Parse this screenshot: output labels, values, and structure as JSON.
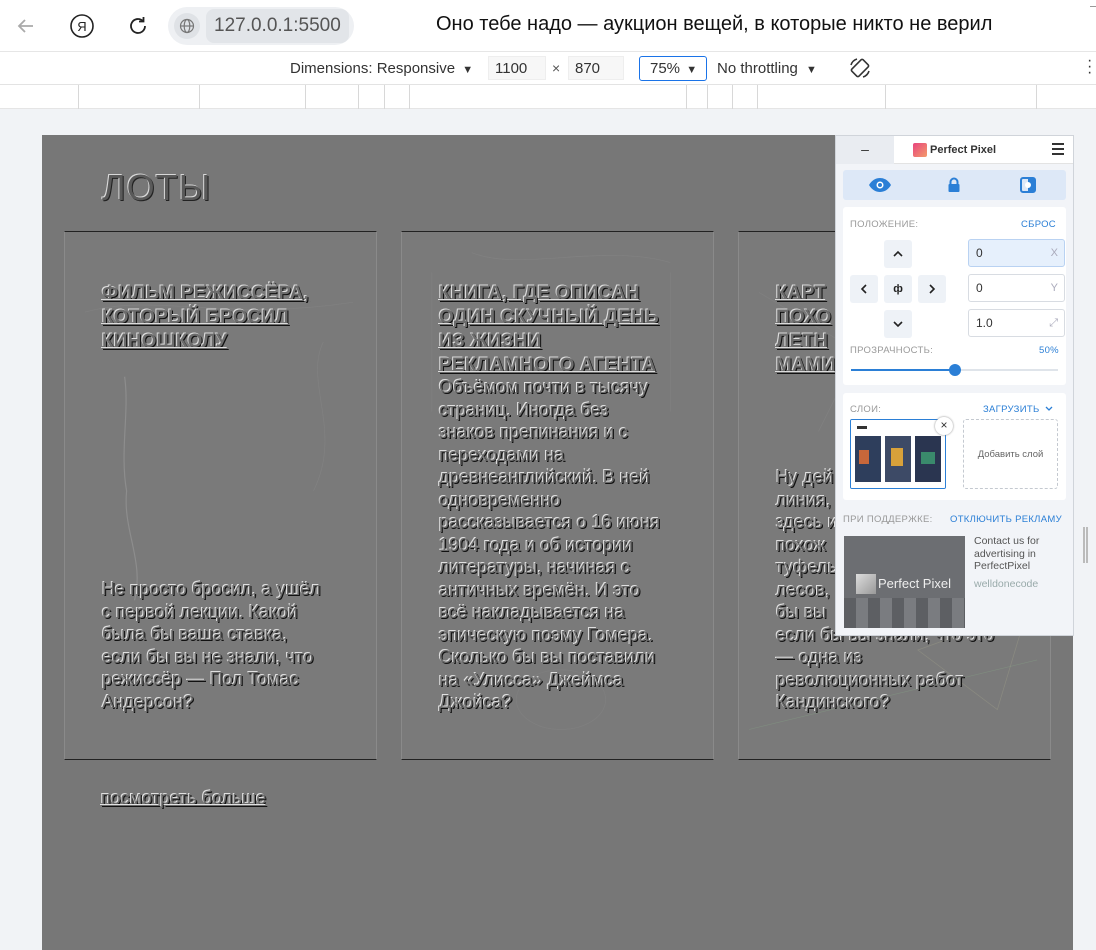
{
  "browser": {
    "url": "127.0.0.1:5500",
    "page_title": "Оно тебе надо — аукцион вещей, в которые никто не верил"
  },
  "devtools": {
    "dimensions_label": "Dimensions: Responsive",
    "width": "1100",
    "times": "×",
    "height": "870",
    "zoom": "75%",
    "throttling": "No throttling",
    "caret": "▼"
  },
  "page": {
    "section_title": "ЛОТЫ",
    "cards": [
      {
        "title_lines": [
          "ФИЛЬМ РЕЖИССЁРА,",
          "КОТОРЫЙ БРОСИЛ",
          "КИНОШКОЛУ"
        ],
        "text_lines": [
          "Не просто бросил, а ушёл",
          "с первой лекции. Какой",
          "была бы ваша ставка,",
          "если бы вы не знали, что",
          "режиссёр — Пол Томас",
          "Андерсон?"
        ]
      },
      {
        "title_lines": [
          "КНИГА, ГДЕ ОПИСАН",
          "ОДИН СКУЧНЫЙ ДЕНЬ",
          "ИЗ ЖИЗНИ",
          "РЕКЛАМНОГО АГЕНТА"
        ],
        "text_lines": [
          "Объёмом почти в тысячу",
          "страниц. Иногда без",
          "знаков препинания и с",
          "переходами на",
          "древнеанглийский. В ней",
          "одновременно",
          "рассказывается о 16 июня",
          "1904 года и об истории",
          "литературы, начиная с",
          "античных времён. И это",
          "всё накладывается на",
          "эпическую поэму Гомера.",
          "Сколько бы вы поставили",
          "на «Улисса» Джеймса",
          "Джойса?"
        ]
      },
      {
        "title_lines": [
          "КАРТ",
          "ПОХО",
          "ЛЕТН",
          "МАМИ"
        ],
        "text_lines": [
          "Ну дей",
          "линия,",
          "здесь и",
          "похож",
          "туфель",
          "лесов,",
          "бы вы",
          "если бы вы знали, что это",
          "— одна из",
          "революционных работ",
          "Кандинского?"
        ]
      }
    ],
    "see_more": "посмотреть больше"
  },
  "perfect_pixel": {
    "minimize": "–",
    "brand": "Perfect Pixel",
    "position_label": "ПОЛОЖЕНИЕ:",
    "reset": "СБРОС",
    "center_btn": "ф",
    "x_value": "0",
    "x_suffix": "X",
    "y_value": "0",
    "y_suffix": "Y",
    "scale_value": "1.0",
    "opacity_label": "ПРОЗРАЧНОСТЬ:",
    "opacity_value": "50%",
    "opacity_fraction": 0.5,
    "layers_label": "СЛОИ:",
    "upload": "ЗАГРУЗИТЬ",
    "add_layer": "Добавить слой",
    "support_label": "ПРИ ПОДДЕРЖКЕ:",
    "disable_ads": "ОТКЛЮЧИТЬ РЕКЛАМУ",
    "ad_brand": "Perfect Pixel",
    "ad_text": "Contact us for advertising in PerfectPixel",
    "ad_domain": "welldonecode"
  }
}
